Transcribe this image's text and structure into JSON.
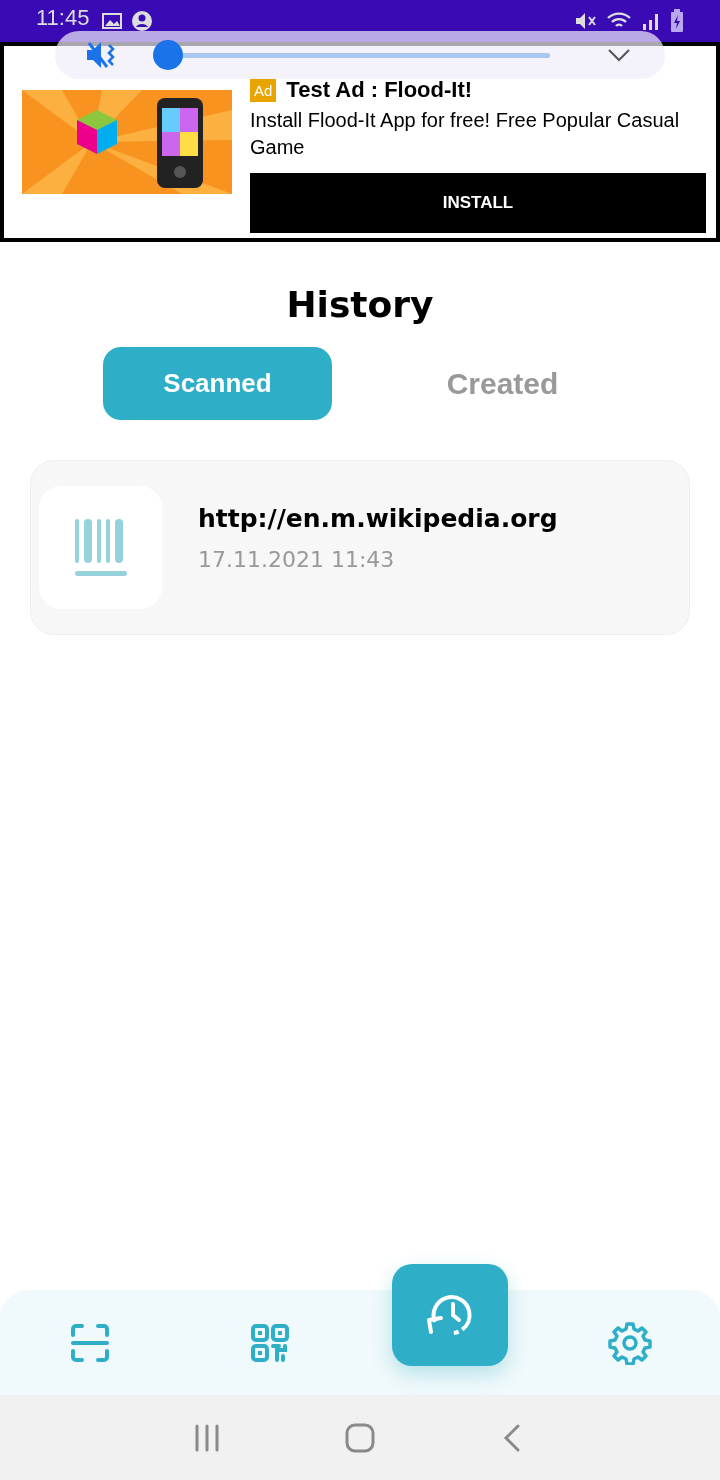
{
  "status_bar": {
    "time": "11:45"
  },
  "volume_panel": {
    "muted": true,
    "level": 0.02
  },
  "ad": {
    "badge": "Ad",
    "title": "Test Ad : Flood-It!",
    "description": "Install Flood-It App for free! Free Popular Casual Game",
    "button": "INSTALL"
  },
  "title": "History",
  "tabs": [
    {
      "label": "Scanned",
      "selected": true
    },
    {
      "label": "Created",
      "selected": false
    }
  ],
  "items": [
    {
      "title": "http://en.m.wikipedia.org",
      "date": "17.11.2021 11:43"
    }
  ],
  "bottom_nav": [
    {
      "kind": "scan",
      "selected": false
    },
    {
      "kind": "qr",
      "selected": false
    },
    {
      "kind": "history",
      "selected": true
    },
    {
      "kind": "settings",
      "selected": false
    }
  ],
  "system_nav": [
    {
      "kind": "recents"
    },
    {
      "kind": "home"
    },
    {
      "kind": "back"
    }
  ]
}
